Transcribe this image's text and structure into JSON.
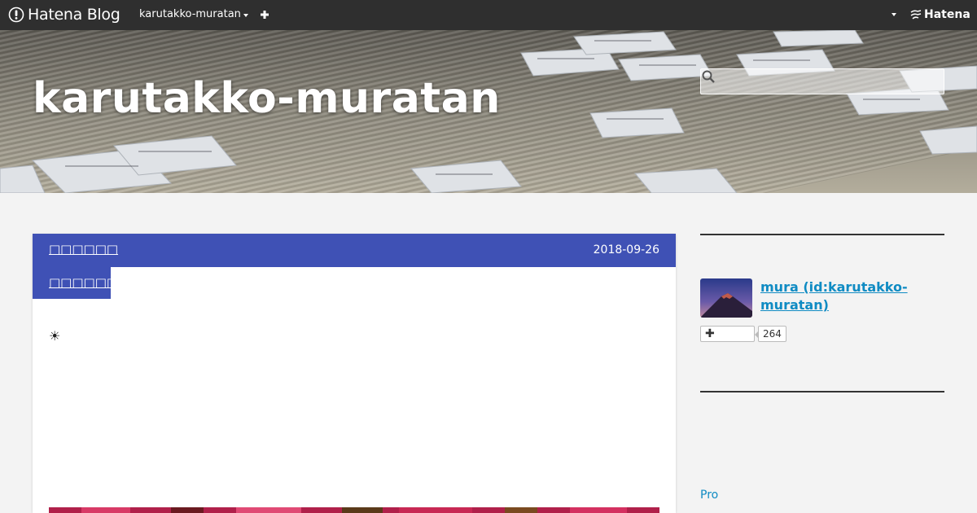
{
  "topbar": {
    "logo_text": "Hatena Blog",
    "blog_menu_label": "karutakko-muratan",
    "hatena_text": "Hatena",
    "icons": {
      "logo": "hatena-blog-logo-icon",
      "add": "plus-icon",
      "user_menu": "chevron-down-icon",
      "hatena": "hatena-logo-icon"
    }
  },
  "header": {
    "title": "karutakko-muratan",
    "search": {
      "placeholder": "",
      "value": ""
    }
  },
  "article": {
    "category_label": "□□□□□□",
    "date": "2018-09-26",
    "title": "□□□□□□",
    "body_lead": "☀",
    "accent_color": "#3f51b5"
  },
  "sidebar": {
    "profile_name": "mura (id:karutakko-muratan)",
    "follow_count": "264",
    "follow_symbol": "✚",
    "pro_label": "Pro",
    "link_color": "#0f8bc3"
  }
}
